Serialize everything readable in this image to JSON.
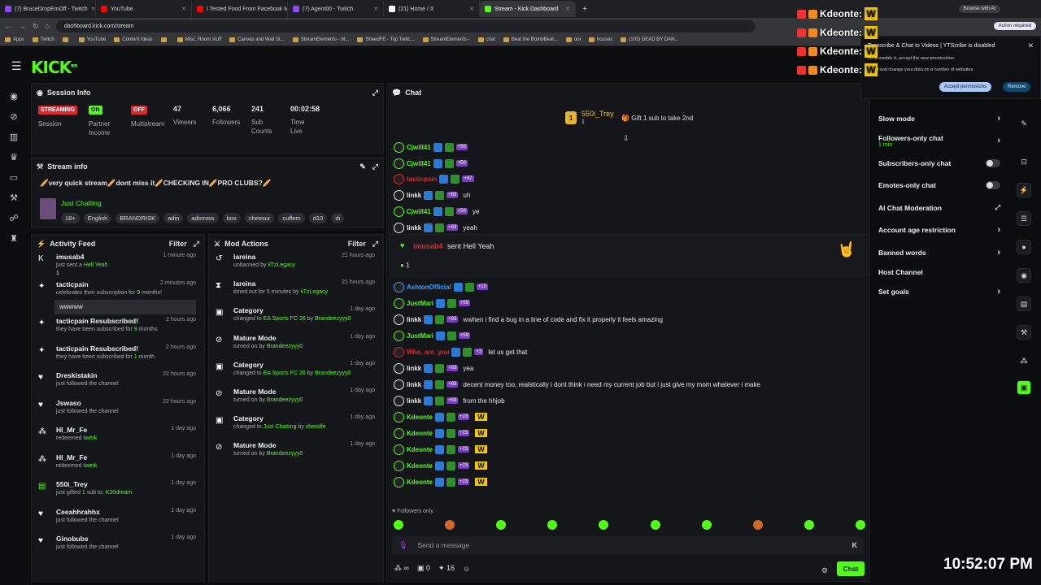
{
  "browser": {
    "tabs": [
      {
        "title": "(7) BruceDropEmOff - Twitch",
        "color": "#9146ff"
      },
      {
        "title": "YouTube",
        "color": "#ff0000"
      },
      {
        "title": "I Tested Food From Facebook M",
        "color": "#ff0000"
      },
      {
        "title": "(7) Agent00 - Twitch",
        "color": "#9146ff"
      },
      {
        "title": "(21) Home / X",
        "color": "#ffffff"
      },
      {
        "title": "Stream - Kick Dashboard",
        "color": "#53fc18"
      }
    ],
    "new_tab": "+",
    "url": "dashboard.kick.com/stream",
    "browse_ai": "Browse with AI",
    "action_required": "Action required",
    "bookmarks": [
      "Apps",
      "Twitch",
      "",
      "YouTube",
      "Content Ideas",
      "",
      "Misc. Room stuff",
      "Canvas and Wall St...",
      "StreamElements - M...",
      "SheedFE - Top Twitc...",
      "StreamElements - ",
      "chat",
      "Beat the BombBeat...",
      "ooi",
      "houses",
      "(103) DEAD BY DAN..."
    ]
  },
  "ext_popup": {
    "title": "Transcribe & Chat to Videos | YTScribe is disabled",
    "line1": "To re-enable it, accept the new permissions:",
    "line2": "Read and change your data on a number of websites",
    "accept": "Accept permissions",
    "remove": "Remove"
  },
  "overlay": {
    "names": [
      "Kdeonte:",
      "Kdeonte:",
      "Kdeonte:",
      "Kdeonte:"
    ],
    "badge_text": "W",
    "clock": "10:52:07 PM"
  },
  "session": {
    "title": "Session Info",
    "items": [
      {
        "pill": "STREAMING",
        "pill_color": "#e0262f",
        "label": "Session"
      },
      {
        "pill": "ON",
        "pill_color": "#53fc18",
        "label": "Partner Income"
      },
      {
        "pill": "OFF",
        "pill_color": "#e0262f",
        "label": "Multistream"
      }
    ],
    "numbers": [
      {
        "value": "47",
        "label": "Viewers"
      },
      {
        "value": "6,066",
        "label": "Followers"
      },
      {
        "value": "241",
        "label": "Sub Counts"
      },
      {
        "value": "00:02:58",
        "label": "Time Live"
      }
    ]
  },
  "stream_info": {
    "title": "Stream info",
    "stream_title": "🥖very quick stream🥖dont miss it🥖CHECKING IN🥖PRO CLUBS?🥖",
    "category": "Just Chatting",
    "tags": [
      "18+",
      "English",
      "BRANDRISK",
      "adin",
      "adinross",
      "box",
      "cheesur",
      "cuffem",
      "d10",
      "di"
    ]
  },
  "activity": {
    "title": "Activity Feed",
    "filter": "Filter",
    "items": [
      {
        "name": "imusab4",
        "sub": "just sent a",
        "hl": "Hell Yeah",
        "time": "1 minute ago",
        "icon": "kick-icon",
        "extra": "1"
      },
      {
        "name": "tacticpain",
        "sub": "celebrates their subscription for",
        "hl": "9",
        "tail": "months!",
        "time": "2 minutes ago",
        "icon": "star-icon",
        "message": "wwwww"
      },
      {
        "name": "tacticpain Resubscribed!",
        "sub": "they have been subscribed for",
        "hl": "9",
        "tail": "months",
        "time": "2 hours ago",
        "icon": "star-icon"
      },
      {
        "name": "tacticpain Resubscribed!",
        "sub": "they have been subscribed for",
        "hl": "1",
        "tail": "month",
        "time": "2 hours ago",
        "icon": "star-icon"
      },
      {
        "name": "Dreskistakin",
        "sub": "just followed the channel",
        "time": "22 hours ago",
        "icon": "heart-icon"
      },
      {
        "name": "Jswaso",
        "sub": "just followed the channel",
        "time": "22 hours ago",
        "icon": "heart-icon"
      },
      {
        "name": "Hl_Mr_Fe",
        "sub": "redeemed",
        "hl": "twerk",
        "time": "1 day ago",
        "icon": "points-icon"
      },
      {
        "name": "Hl_Mr_Fe",
        "sub": "redeemed",
        "hl": "twerk",
        "time": "1 day ago",
        "icon": "points-icon"
      },
      {
        "name": "550i_Trey",
        "sub": "just gifted",
        "hl": "1",
        "tail": "sub to:",
        "hl2": "K20dream",
        "time": "1 day ago",
        "icon": "gift-icon"
      },
      {
        "name": "Ceeahhrahhx",
        "sub": "just followed the channel",
        "time": "1 day ago",
        "icon": "heart-icon"
      },
      {
        "name": "Ginobubs",
        "sub": "just followed the channel",
        "time": "1 day ago",
        "icon": "heart-icon"
      }
    ]
  },
  "mod": {
    "title": "Mod Actions",
    "filter": "Filter",
    "items": [
      {
        "name": "lareina",
        "sub": "unbanned by",
        "hl": "iiTzLegacy",
        "time": "21 hours ago",
        "icon": "undo-icon"
      },
      {
        "name": "lareina",
        "sub": "timed out for 5 minutes by",
        "hl": "iiTzLegacy",
        "time": "21 hours ago",
        "icon": "hourglass-icon"
      },
      {
        "name": "Category",
        "sub": "changed to",
        "hl": "EA Sports FC 26",
        "mid": "by",
        "hl2": "Brandeezyyy0",
        "time": "1 day ago",
        "icon": "category-icon"
      },
      {
        "name": "Mature Mode",
        "sub": "turned on by",
        "hl": "Brandeezyyy0",
        "time": "1 day ago",
        "icon": "eye-off-icon"
      },
      {
        "name": "Category",
        "sub": "changed to",
        "hl": "EA Sports FC 26",
        "mid": "by",
        "hl2": "Brandeezyyy0",
        "time": "1 day ago",
        "icon": "category-icon"
      },
      {
        "name": "Mature Mode",
        "sub": "turned on by",
        "hl": "Brandeezyyy0",
        "time": "1 day ago",
        "icon": "eye-off-icon"
      },
      {
        "name": "Category",
        "sub": "changed to",
        "hl": "Just Chatting",
        "mid": "by",
        "hl2": "sheedfe",
        "time": "1 day ago",
        "icon": "category-icon"
      },
      {
        "name": "Mature Mode",
        "sub": "turned on by",
        "hl": "Brandeezyyy0",
        "time": "1 day ago",
        "icon": "eye-off-icon"
      }
    ]
  },
  "chat": {
    "title": "Chat",
    "top_gifter": "550i_Trey",
    "top_gifter_count": "1",
    "top_rank": "1",
    "gift_prompt": "Gift 1 sub to take 2nd",
    "highlight": {
      "user": "imusab4",
      "text": "sent Hell Yeah",
      "count": "1"
    },
    "messages": [
      {
        "user": "Cjwill41",
        "color": "#53fc18",
        "badge": "+50",
        "text": ""
      },
      {
        "user": "Cjwill41",
        "color": "#53fc18",
        "badge": "+50",
        "text": ""
      },
      {
        "user": "tacticpain",
        "color": "#e0262f",
        "badge": "+47",
        "text": ""
      },
      {
        "user": "linkk",
        "color": "#e6e6e6",
        "badge": "+83",
        "text": "uh"
      },
      {
        "user": "Cjwill41",
        "color": "#53fc18",
        "badge": "+50",
        "text": "ye"
      },
      {
        "user": "linkk",
        "color": "#e6e6e6",
        "badge": "+83",
        "text": "yeah"
      },
      {
        "user": "AshtonOfficial",
        "color": "#3aa0ff",
        "badge": "+15",
        "text": ""
      },
      {
        "user": "JustMari",
        "color": "#53fc18",
        "badge": "+59",
        "text": ""
      },
      {
        "user": "linkk",
        "color": "#e6e6e6",
        "badge": "+83",
        "text": "wwhen i find a bug in a line of code and fix it properly it feels amazing"
      },
      {
        "user": "JustMari",
        "color": "#53fc18",
        "badge": "+59",
        "text": ""
      },
      {
        "user": "Who_are_you",
        "color": "#e0262f",
        "badge": "+3",
        "text": "let us get that"
      },
      {
        "user": "linkk",
        "color": "#e6e6e6",
        "badge": "+83",
        "text": "yea"
      },
      {
        "user": "linkk",
        "color": "#e6e6e6",
        "badge": "+83",
        "text": "decent money too, realstically i dont think i need my current job but i just give my mom whatever i make"
      },
      {
        "user": "linkk",
        "color": "#e6e6e6",
        "badge": "+83",
        "text": "from the hhjob"
      },
      {
        "user": "Kdeonte",
        "color": "#53fc18",
        "badge": "+23",
        "text": "W"
      },
      {
        "user": "Kdeonte",
        "color": "#53fc18",
        "badge": "+23",
        "text": "W"
      },
      {
        "user": "Kdeonte",
        "color": "#53fc18",
        "badge": "+23",
        "text": "W"
      },
      {
        "user": "Kdeonte",
        "color": "#53fc18",
        "badge": "+23",
        "text": "W"
      },
      {
        "user": "Kdeonte",
        "color": "#53fc18",
        "badge": "+23",
        "text": "W"
      }
    ],
    "followers_only": "Followers only",
    "placeholder": "Send a message",
    "bottom": {
      "infinity": "∞",
      "count_a": "0",
      "count_b": "16"
    },
    "chat_button": "Chat"
  },
  "settings": {
    "items": [
      {
        "label": "Slow mode",
        "kind": "chevron"
      },
      {
        "label": "Followers-only chat",
        "sub": "1 min",
        "kind": "chevron"
      },
      {
        "label": "Subscribers-only chat",
        "kind": "toggle"
      },
      {
        "label": "Emotes-only chat",
        "kind": "toggle"
      },
      {
        "label": "AI Chat Moderation",
        "kind": "external"
      },
      {
        "label": "Account age restriction",
        "kind": "chevron"
      },
      {
        "label": "Banned words",
        "kind": "chevron"
      },
      {
        "label": "Host Channel",
        "kind": "none"
      },
      {
        "label": "Set goals",
        "kind": "chevron"
      }
    ]
  },
  "brand": {
    "logo": "KICK",
    "beta": "BETA",
    "accent": "#53fc18"
  }
}
